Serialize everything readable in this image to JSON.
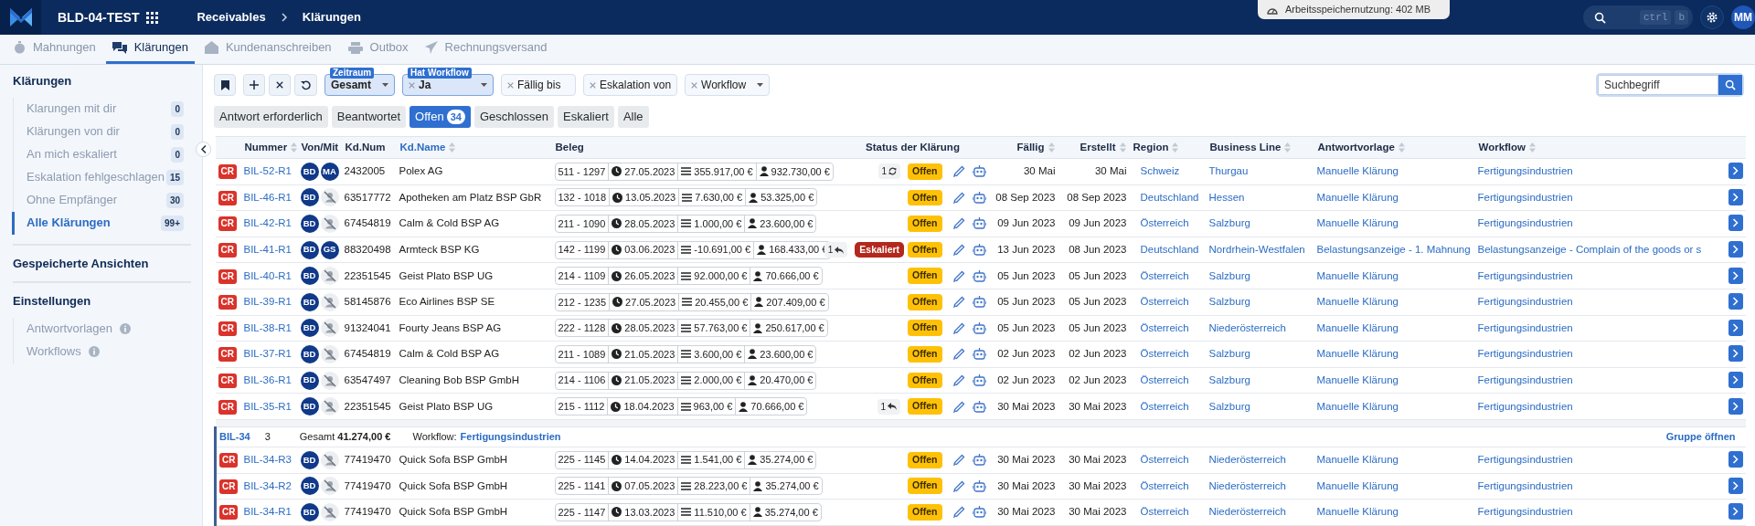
{
  "header": {
    "app": "BLD-04-TEST",
    "breadcrumbs": [
      "Receivables",
      "Klärungen"
    ],
    "memory": "Arbeitsspeichernutzung: 402 MB",
    "search_keys": [
      "ctrl",
      "b"
    ],
    "avatar": "MM"
  },
  "tabs": [
    {
      "label": "Mahnungen",
      "selected": false
    },
    {
      "label": "Klärungen",
      "selected": true
    },
    {
      "label": "Kundenanschreiben",
      "selected": false
    },
    {
      "label": "Outbox",
      "selected": false
    },
    {
      "label": "Rechnungsversand",
      "selected": false
    }
  ],
  "sidebar": {
    "title": "Klärungen",
    "items": [
      {
        "label": "Klarungen mit dir",
        "count": "0",
        "selected": false
      },
      {
        "label": "Klärungen von dir",
        "count": "0",
        "selected": false
      },
      {
        "label": "An mich eskaliert",
        "count": "0",
        "selected": false
      },
      {
        "label": "Eskalation fehlgeschlagen",
        "count": "15",
        "selected": false
      },
      {
        "label": "Ohne Empfänger",
        "count": "30",
        "selected": false
      },
      {
        "label": "Alle Klärungen",
        "count": "99+",
        "selected": true
      }
    ],
    "saved_views": "Gespeicherte Ansichten",
    "settings": {
      "title": "Einstellungen",
      "items": [
        "Antwortvorlagen",
        "Workflows"
      ]
    }
  },
  "filters": [
    {
      "kind": "select",
      "label": "Zeitraum",
      "value": "Gesamt",
      "removable": false,
      "active": true
    },
    {
      "kind": "select",
      "label": "Hat Workflow",
      "value": "Ja",
      "removable": true,
      "active": true
    },
    {
      "kind": "text",
      "value": "Fällig bis",
      "removable": true,
      "active": false
    },
    {
      "kind": "plain",
      "value": "Eskalation von",
      "removable": true,
      "active": false
    },
    {
      "kind": "select",
      "value": "Workflow",
      "removable": true,
      "active": false
    }
  ],
  "search": {
    "placeholder": "Suchbegriff"
  },
  "status_filters": [
    {
      "label": "Antwort erforderlich",
      "selected": false
    },
    {
      "label": "Beantwortet",
      "selected": false
    },
    {
      "label": "Offen",
      "count": "34",
      "selected": true
    },
    {
      "label": "Geschlossen",
      "selected": false
    },
    {
      "label": "Eskaliert",
      "selected": false
    },
    {
      "label": "Alle",
      "selected": false
    }
  ],
  "table": {
    "columns": [
      {
        "label": "Nummer",
        "sortable": true,
        "sorted": false
      },
      {
        "label": "Von/Mit",
        "sortable": false,
        "sorted": false
      },
      {
        "label": "Kd.Num",
        "sortable": false,
        "sorted": false
      },
      {
        "label": "Kd.Name",
        "sortable": true,
        "sorted": true
      },
      {
        "label": "Beleg",
        "sortable": false,
        "sorted": false
      },
      {
        "label": "Status der Klärung",
        "sortable": false,
        "sorted": false
      },
      {
        "label": "Fällig",
        "sortable": true,
        "sorted": false
      },
      {
        "label": "Erstellt",
        "sortable": true,
        "sorted": false
      },
      {
        "label": "Region",
        "sortable": true,
        "sorted": false
      },
      {
        "label": "Business Line",
        "sortable": true,
        "sorted": false
      },
      {
        "label": "Antwortvorlage",
        "sortable": true,
        "sorted": false
      },
      {
        "label": "Workflow",
        "sortable": true,
        "sorted": false
      }
    ],
    "rows": [
      {
        "type": "CR",
        "number": "BIL-52-R1",
        "von": "BD",
        "mit": "MA",
        "kd_num": "2432005",
        "kd_name": "Polex AG",
        "beleg": [
          "511 - 1297",
          "27.05.2023",
          "355.917,00 €",
          "932.730,00 €"
        ],
        "counter": {
          "text": "1",
          "kind": "sync"
        },
        "status": "Offen",
        "faellig": "30 Mai",
        "erstellt": "30 Mai",
        "region": "Schweiz",
        "business_line": "Thurgau",
        "antwortvorlage": "Manuelle Klärung",
        "workflow": "Fertigungsindustrien"
      },
      {
        "type": "CR",
        "number": "BIL-46-R1",
        "von": "BD",
        "kd_num": "63517772",
        "kd_name": "Apotheken am Platz BSP GbR",
        "beleg": [
          "132 - 1018",
          "13.05.2023",
          "7.630,00 €",
          "53.325,00 €"
        ],
        "status": "Offen",
        "faellig": "08 Sep 2023",
        "erstellt": "08 Sep 2023",
        "region": "Deutschland",
        "business_line": "Hessen",
        "antwortvorlage": "Manuelle Klärung",
        "workflow": "Fertigungsindustrien"
      },
      {
        "type": "CR",
        "number": "BIL-42-R1",
        "von": "BD",
        "kd_num": "67454819",
        "kd_name": "Calm & Cold BSP AG",
        "beleg": [
          "211 - 1090",
          "28.05.2023",
          "1.000,00 €",
          "23.600,00 €"
        ],
        "status": "Offen",
        "faellig": "09 Jun 2023",
        "erstellt": "09 Jun 2023",
        "region": "Österreich",
        "business_line": "Salzburg",
        "antwortvorlage": "Manuelle Klärung",
        "workflow": "Fertigungsindustrien"
      },
      {
        "type": "CR",
        "number": "BIL-41-R1",
        "von": "BD",
        "mit": "GS",
        "kd_num": "88320498",
        "kd_name": "Armteck BSP KG",
        "beleg": [
          "142 - 1199",
          "03.06.2023",
          "-10.691,00 €",
          "168.433,00 €"
        ],
        "counter": {
          "text": "1",
          "kind": "reply"
        },
        "escalation": "Eskaliert",
        "status": "Offen",
        "faellig": "13 Jun 2023",
        "erstellt": "08 Jun 2023",
        "region": "Deutschland",
        "business_line": "Nordrhein-Westfalen",
        "antwortvorlage": "Belastungsanzeige - 1. Mahnung",
        "workflow": "Belastungsanzeige - Complain of the goods or s"
      },
      {
        "type": "CR",
        "number": "BIL-40-R1",
        "von": "BD",
        "kd_num": "22351545",
        "kd_name": "Geist Plato BSP UG",
        "beleg": [
          "214 - 1109",
          "26.05.2023",
          "92.000,00 €",
          "70.666,00 €"
        ],
        "status": "Offen",
        "faellig": "05 Jun 2023",
        "erstellt": "05 Jun 2023",
        "region": "Österreich",
        "business_line": "Salzburg",
        "antwortvorlage": "Manuelle Klärung",
        "workflow": "Fertigungsindustrien"
      },
      {
        "type": "CR",
        "number": "BIL-39-R1",
        "von": "BD",
        "kd_num": "58145876",
        "kd_name": "Eco Airlines BSP SE",
        "beleg": [
          "212 - 1235",
          "27.05.2023",
          "20.455,00 €",
          "207.409,00 €"
        ],
        "status": "Offen",
        "faellig": "05 Jun 2023",
        "erstellt": "05 Jun 2023",
        "region": "Österreich",
        "business_line": "Salzburg",
        "antwortvorlage": "Manuelle Klärung",
        "workflow": "Fertigungsindustrien"
      },
      {
        "type": "CR",
        "number": "BIL-38-R1",
        "von": "BD",
        "kd_num": "91324041",
        "kd_name": "Fourty Jeans BSP AG",
        "beleg": [
          "222 - 1128",
          "28.05.2023",
          "57.763,00 €",
          "250.617,00 €"
        ],
        "status": "Offen",
        "faellig": "05 Jun 2023",
        "erstellt": "05 Jun 2023",
        "region": "Österreich",
        "business_line": "Niederösterreich",
        "antwortvorlage": "Manuelle Klärung",
        "workflow": "Fertigungsindustrien"
      },
      {
        "type": "CR",
        "number": "BIL-37-R1",
        "von": "BD",
        "kd_num": "67454819",
        "kd_name": "Calm & Cold BSP AG",
        "beleg": [
          "211 - 1089",
          "21.05.2023",
          "3.600,00 €",
          "23.600,00 €"
        ],
        "status": "Offen",
        "faellig": "02 Jun 2023",
        "erstellt": "02 Jun 2023",
        "region": "Österreich",
        "business_line": "Salzburg",
        "antwortvorlage": "Manuelle Klärung",
        "workflow": "Fertigungsindustrien"
      },
      {
        "type": "CR",
        "number": "BIL-36-R1",
        "von": "BD",
        "kd_num": "63547497",
        "kd_name": "Cleaning Bob BSP GmbH",
        "beleg": [
          "214 - 1106",
          "21.05.2023",
          "2.000,00 €",
          "20.470,00 €"
        ],
        "status": "Offen",
        "faellig": "02 Jun 2023",
        "erstellt": "02 Jun 2023",
        "region": "Österreich",
        "business_line": "Salzburg",
        "antwortvorlage": "Manuelle Klärung",
        "workflow": "Fertigungsindustrien"
      },
      {
        "type": "CR",
        "number": "BIL-35-R1",
        "von": "BD",
        "kd_num": "22351545",
        "kd_name": "Geist Plato BSP UG",
        "beleg": [
          "215 - 1112",
          "18.04.2023",
          "963,00 €",
          "70.666,00 €"
        ],
        "counter": {
          "text": "1",
          "kind": "reply"
        },
        "status": "Offen",
        "faellig": "30 Mai 2023",
        "erstellt": "30 Mai 2023",
        "region": "Österreich",
        "business_line": "Salzburg",
        "antwortvorlage": "Manuelle Klärung",
        "workflow": "Fertigungsindustrien"
      }
    ],
    "group": {
      "id": "BIL-34",
      "count": "3",
      "total": "Gesamt **41.274,00 €**",
      "workflow_label": "Workflow:",
      "workflow": "Fertigungsindustrien",
      "open_link": "Gruppe öffnen",
      "rows": [
        {
          "type": "CR",
          "number": "BIL-34-R3",
          "von": "BD",
          "kd_num": "77419470",
          "kd_name": "Quick Sofa BSP GmbH",
          "beleg": [
            "225 - 1145",
            "14.04.2023",
            "1.541,00 €",
            "35.274,00 €"
          ],
          "status": "Offen",
          "faellig": "30 Mai 2023",
          "erstellt": "30 Mai 2023",
          "region": "Österreich",
          "business_line": "Niederösterreich",
          "antwortvorlage": "Manuelle Klärung",
          "workflow": "Fertigungsindustrien"
        },
        {
          "type": "CR",
          "number": "BIL-34-R2",
          "von": "BD",
          "kd_num": "77419470",
          "kd_name": "Quick Sofa BSP GmbH",
          "beleg": [
            "225 - 1141",
            "07.05.2023",
            "28.223,00 €",
            "35.274,00 €"
          ],
          "status": "Offen",
          "faellig": "30 Mai 2023",
          "erstellt": "30 Mai 2023",
          "region": "Österreich",
          "business_line": "Niederösterreich",
          "antwortvorlage": "Manuelle Klärung",
          "workflow": "Fertigungsindustrien"
        },
        {
          "type": "CR",
          "number": "BIL-34-R1",
          "von": "BD",
          "kd_num": "77419470",
          "kd_name": "Quick Sofa BSP GmbH",
          "beleg": [
            "225 - 1147",
            "13.03.2023",
            "11.510,00 €",
            "35.274,00 €"
          ],
          "status": "Offen",
          "faellig": "30 Mai 2023",
          "erstellt": "30 Mai 2023",
          "region": "Österreich",
          "business_line": "Niederösterreich",
          "antwortvorlage": "Manuelle Klärung",
          "workflow": "Fertigungsindustrien"
        }
      ]
    }
  }
}
